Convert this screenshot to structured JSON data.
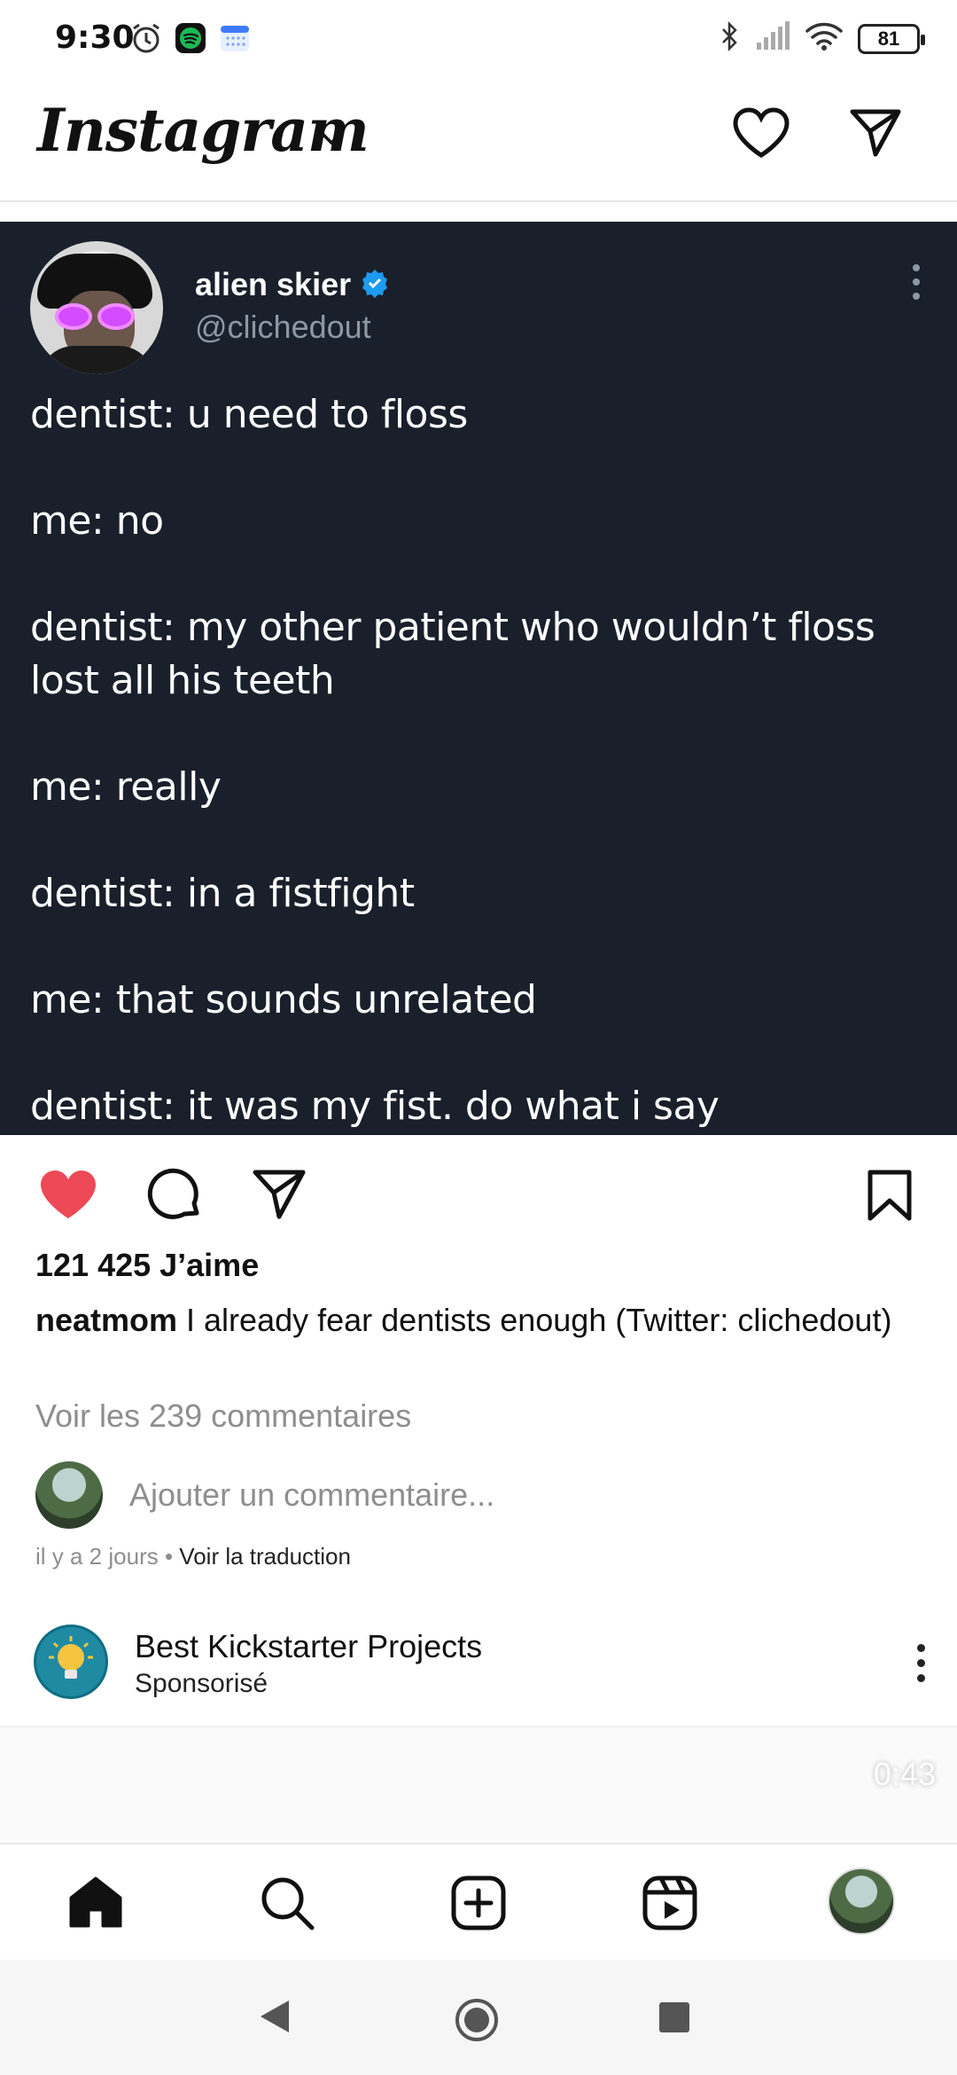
{
  "status_bar": {
    "time": "9:30",
    "battery": "81",
    "icons": [
      "alarm-icon",
      "spotify-icon",
      "calendar-icon",
      "bluetooth-icon",
      "signal-icon",
      "wifi-icon",
      "battery-icon"
    ]
  },
  "header": {
    "logo": "Instagram",
    "icons": [
      "chevron-down-icon",
      "heart-icon",
      "send-icon"
    ]
  },
  "tweet": {
    "name": "alien skier",
    "handle": "@clichedout",
    "verified": true,
    "text": "dentist: u need to floss\n\nme: no\n\ndentist: my other patient who wouldn’t floss lost all his teeth\n\nme: really\n\ndentist: in a fistfight\n\nme: that sounds unrelated\n\ndentist: it was my fist. do what i say"
  },
  "post": {
    "likes": "121 425 J’aime",
    "caption_user": "neatmom",
    "caption_text": " I already fear dentists enough (Twitter: clichedout)",
    "view_comments": "Voir les 239 commentaires",
    "add_comment_placeholder": "Ajouter un commentaire...",
    "time_ago": "il y a 2 jours",
    "separator": " • ",
    "translate": "Voir la traduction"
  },
  "sponsored": {
    "name": "Best Kickstarter Projects",
    "label": "Sponsorisé",
    "video_time": "0:43"
  },
  "colors": {
    "tweet_bg": "#19202b",
    "like_red": "#ed4956",
    "verified_blue": "#1d9bf0",
    "muted_text": "#8e8e8e"
  },
  "bottom_nav": [
    "home-icon",
    "search-icon",
    "add-post-icon",
    "reels-icon",
    "profile-avatar"
  ],
  "system_nav": [
    "back-icon",
    "home-circle-icon",
    "recents-icon"
  ]
}
